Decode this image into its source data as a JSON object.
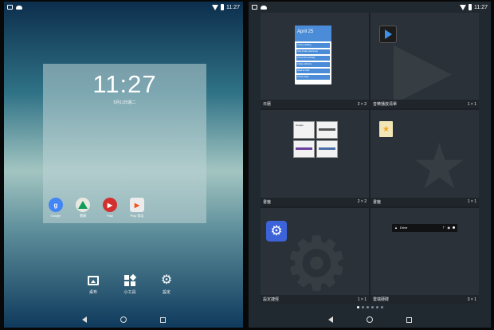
{
  "status_bar": {
    "time": "11:27"
  },
  "home_preview": {
    "clock": "11:27",
    "date": "5月11日週二",
    "apps": [
      {
        "label": "Google",
        "icon": "google-icon"
      },
      {
        "label": "雲端",
        "icon": "drive-icon"
      },
      {
        "label": "Play",
        "icon": "play-icon"
      },
      {
        "label": "Play 商店",
        "icon": "play-store-icon"
      }
    ]
  },
  "edit_bar": {
    "wallpaper_label": "桌布",
    "widgets_label": "小工具",
    "settings_label": "設定"
  },
  "widgets": [
    {
      "name": "日曆",
      "size": "2 × 2"
    },
    {
      "name": "音樂播放清單",
      "size": "1 × 1"
    },
    {
      "name": "書籤",
      "size": "2 × 2"
    },
    {
      "name": "書籤",
      "size": "1 × 1"
    },
    {
      "name": "設定捷徑",
      "size": "1 × 1"
    },
    {
      "name": "雲端硬碟",
      "size": "3 × 1"
    }
  ],
  "calendar_widget": {
    "header": "April 25",
    "events": [
      "3 Story drafting",
      "Give & take (stand-up)",
      "Prince Fil's birthday",
      "Coffee with Eric",
      "Read at Cafe",
      "Family Saga"
    ]
  },
  "bookmark_widget": {
    "thumb1": "Google",
    "thumb2": ""
  },
  "drive_widget": {
    "label": "Drive"
  },
  "pager": {
    "pages": 6,
    "active": 0
  },
  "colors": {
    "panel_bg": "#212930",
    "calendar_blue": "#4a8cd8",
    "settings_blue": "#3d63d9"
  }
}
